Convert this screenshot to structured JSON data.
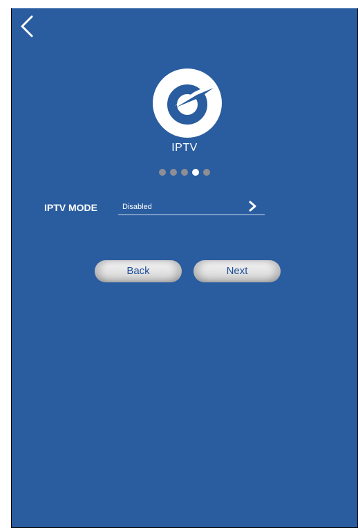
{
  "screen": {
    "background_color": "#2a5d9f",
    "back_icon": "chevron-left-icon",
    "logo_icon": "power-e-logo-icon",
    "title": "IPTV",
    "progress": {
      "total_steps": 5,
      "current_step": 4
    }
  },
  "form": {
    "mode_label": "IPTV MODE",
    "mode_value": "Disabled",
    "mode_chevron_icon": "chevron-right-icon"
  },
  "buttons": {
    "back_label": "Back",
    "next_label": "Next",
    "text_color": "#1f4f9a"
  }
}
